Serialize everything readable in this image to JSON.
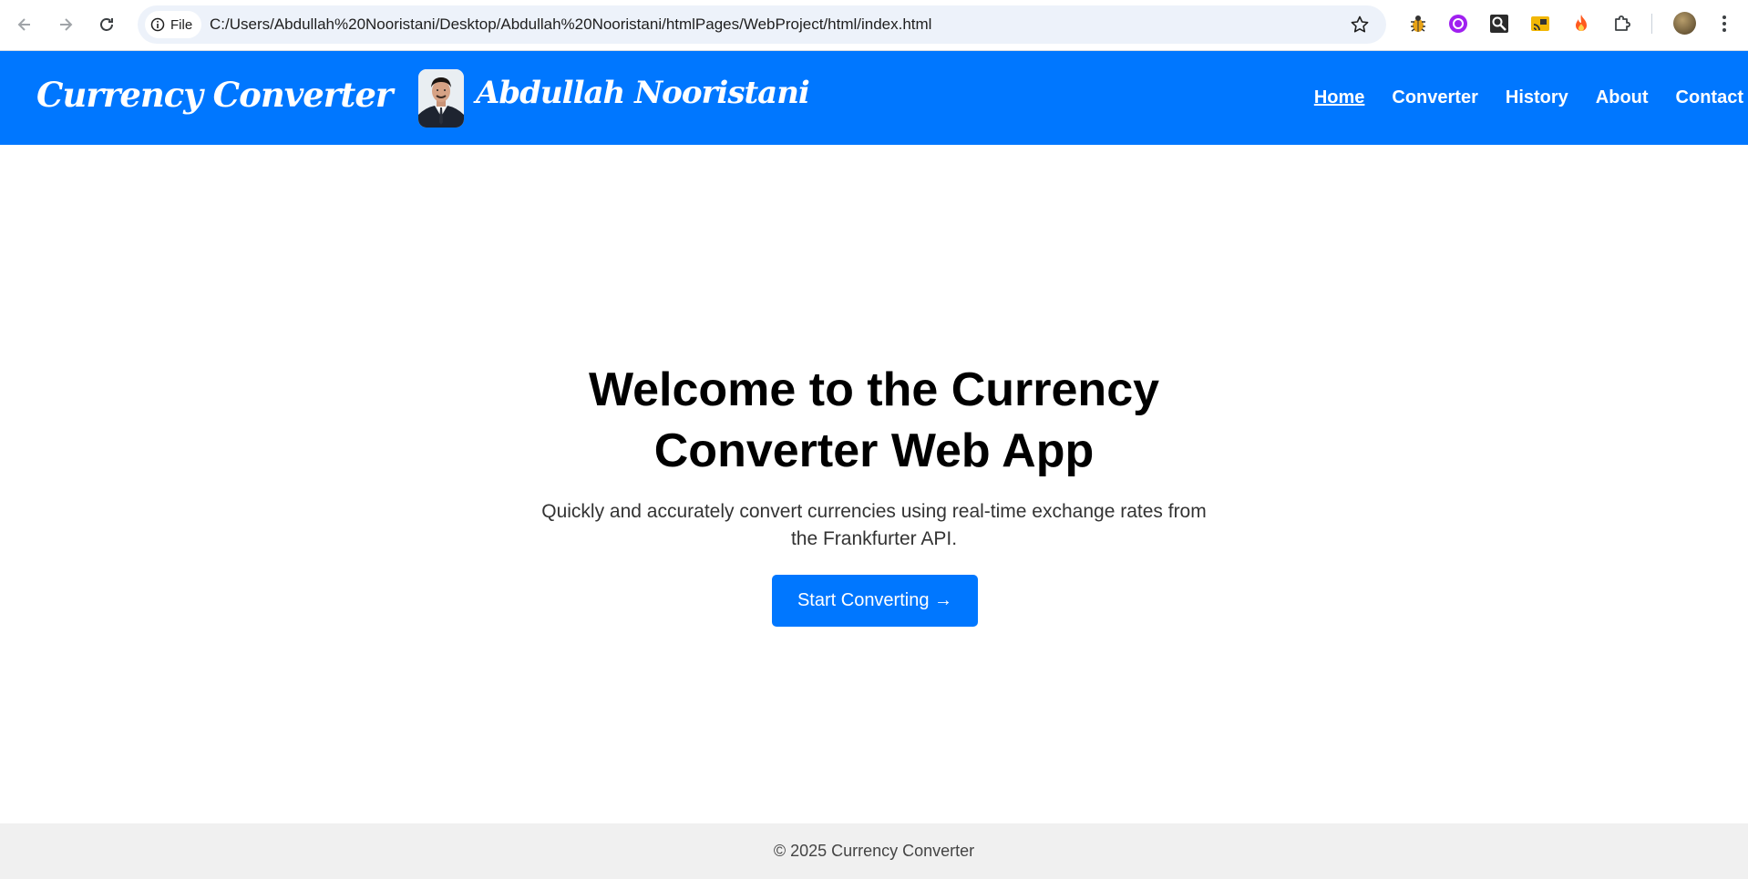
{
  "browser": {
    "chip_label": "File",
    "url": "C:/Users/Abdullah%20Nooristani/Desktop/Abdullah%20Nooristani/htmlPages/WebProject/html/index.html",
    "extensions": [
      "bug-extension-icon",
      "purple-circle-extension-icon",
      "magnifier-extension-icon",
      "cast-extension-icon",
      "flame-extension-icon",
      "puzzle-extensions-icon"
    ]
  },
  "header": {
    "brand": "Currency Converter",
    "author": "Abdullah Nooristani",
    "nav": [
      {
        "label": "Home",
        "active": true
      },
      {
        "label": "Converter",
        "active": false
      },
      {
        "label": "History",
        "active": false
      },
      {
        "label": "About",
        "active": false
      },
      {
        "label": "Contact",
        "active": false
      }
    ]
  },
  "hero": {
    "title": "Welcome to the Currency Converter Web App",
    "subtitle": "Quickly and accurately convert currencies using real-time exchange rates from the Frankfurter API.",
    "cta_label": "Start Converting →"
  },
  "footer": {
    "text": "© 2025 Currency Converter"
  },
  "colors": {
    "primary": "#0077ff",
    "footer_bg": "#f0f0f0",
    "omnibox_bg": "#edf2fa"
  }
}
